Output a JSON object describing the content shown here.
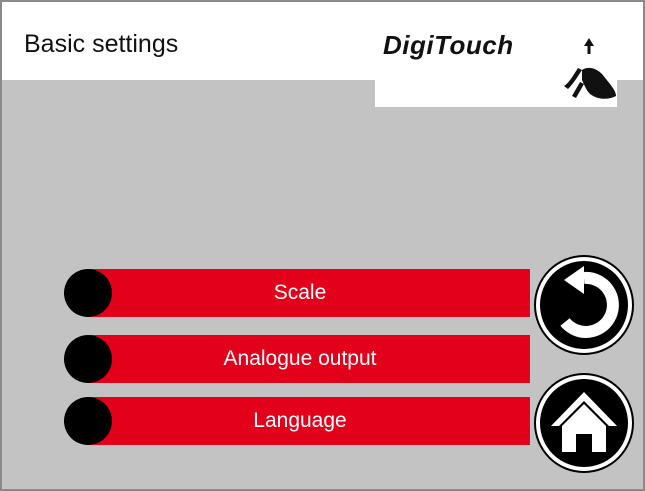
{
  "header": {
    "title": "Basic settings",
    "logo_text": "DigiTouch"
  },
  "menu": {
    "items": [
      {
        "label": "Scale"
      },
      {
        "label": "Analogue output"
      },
      {
        "label": "Language"
      }
    ]
  },
  "nav": {
    "back_icon": "back-icon",
    "home_icon": "home-icon"
  },
  "colors": {
    "accent": "#e2001a",
    "background": "#c3c3c3",
    "header": "#ffffff"
  }
}
